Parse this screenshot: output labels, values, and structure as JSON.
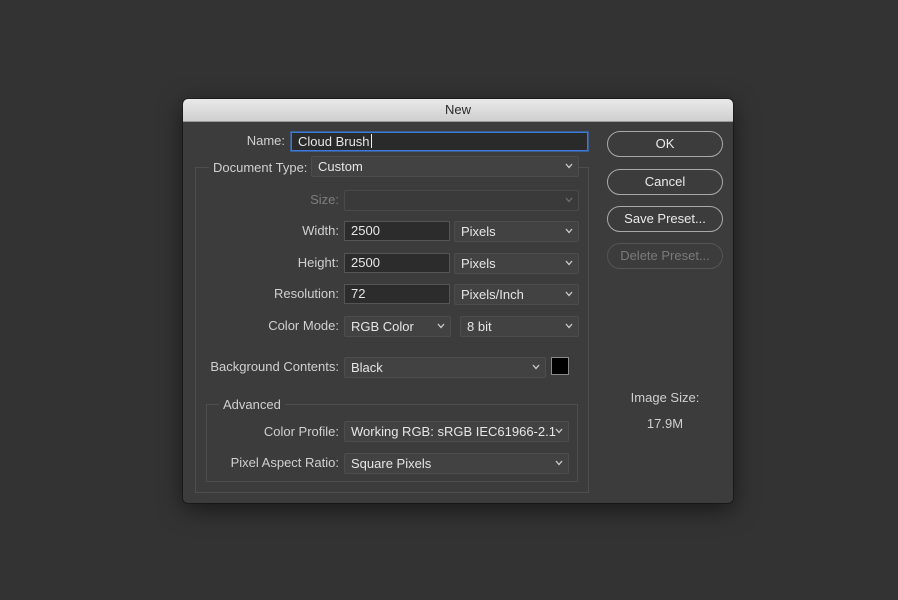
{
  "dialog": {
    "title": "New"
  },
  "name": {
    "label": "Name:",
    "value": "Cloud Brush"
  },
  "document_type": {
    "label": "Document Type:",
    "value": "Custom"
  },
  "size": {
    "label": "Size:",
    "value": ""
  },
  "width": {
    "label": "Width:",
    "value": "2500",
    "unit": "Pixels"
  },
  "height": {
    "label": "Height:",
    "value": "2500",
    "unit": "Pixels"
  },
  "resolution": {
    "label": "Resolution:",
    "value": "72",
    "unit": "Pixels/Inch"
  },
  "color_mode": {
    "label": "Color Mode:",
    "mode": "RGB Color",
    "depth": "8 bit"
  },
  "background": {
    "label": "Background Contents:",
    "value": "Black",
    "swatch_color": "#000000"
  },
  "advanced": {
    "title": "Advanced",
    "color_profile": {
      "label": "Color Profile:",
      "value": "Working RGB:  sRGB IEC61966-2.1"
    },
    "pixel_aspect": {
      "label": "Pixel Aspect Ratio:",
      "value": "Square Pixels"
    }
  },
  "buttons": {
    "ok": "OK",
    "cancel": "Cancel",
    "save_preset": "Save Preset...",
    "delete_preset": "Delete Preset..."
  },
  "image_size": {
    "label": "Image Size:",
    "value": "17.9M"
  },
  "icons": {
    "dropdown": "chevron-down-icon"
  }
}
